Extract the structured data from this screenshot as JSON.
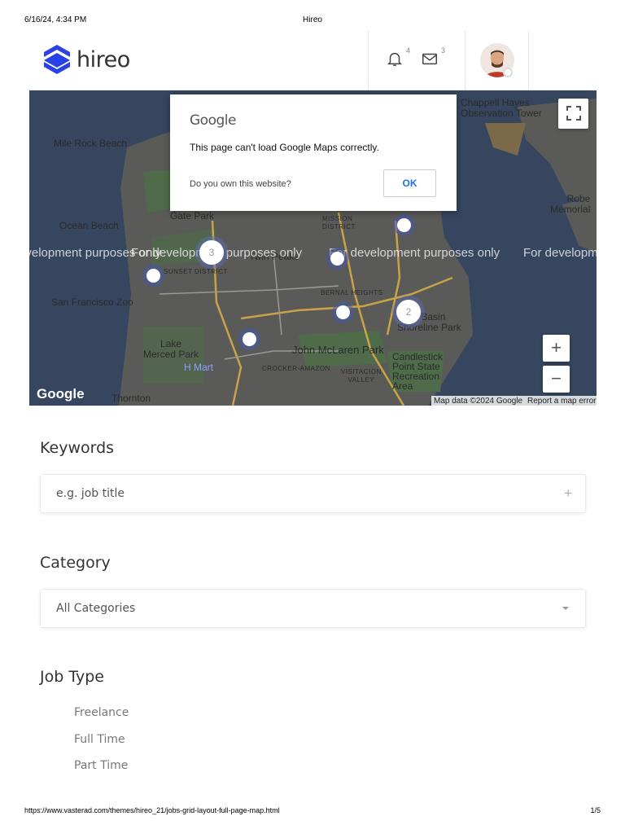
{
  "print": {
    "date": "6/16/24, 4:34 PM",
    "title": "Hireo",
    "url": "https://www.vasterad.com/themes/hireo_21/jobs-grid-layout-full-page-map.html",
    "page": "1/5"
  },
  "header": {
    "logo_text": "hireo",
    "notifications_count": "4",
    "messages_count": "3"
  },
  "map": {
    "labels": {
      "mile_rock_beach": "Mile Rock Beach",
      "ocean_beach": "Ocean Beach",
      "gate_park": "Gate Park",
      "mission_district": "MISSION\nDISTRICT",
      "sunset_district": "SUNSET DISTRICT",
      "san_francisco_zoo": "San Francisco Zoo",
      "lake_merced_park": "Lake\nMerced Park",
      "mart": "H Mart",
      "john_mclaren_park": "John McLaren Park",
      "crocker_amazon": "CROCKER-AMAZON",
      "visitacion_valley": "VISITACION\nVALLEY",
      "bernal_heights": "BERNAL HEIGHTS",
      "candlestick": "Candlestick\nPoint State\nRecreation\nArea",
      "india_basin": "India Basin\nShoreline Park",
      "chappell_hayes": "Chappell Hayes\nObservation Tower",
      "roberts_memorial": "Robe\nMemorial",
      "thornton": "Thornton",
      "twin_peaks": "Twin Peaks"
    },
    "dev_watermark": "For development purposes only",
    "clusters": [
      "3",
      "2"
    ],
    "zoom_in": "+",
    "zoom_out": "−",
    "google_logo": "Google",
    "attribution": "Map data ©2024 Google",
    "report_error": "Report a map error",
    "dialog": {
      "logo": "Google",
      "message": "This page can't load Google Maps correctly.",
      "question": "Do you own this website?",
      "ok": "OK"
    }
  },
  "keywords": {
    "title": "Keywords",
    "placeholder": "e.g. job title",
    "icon": "+"
  },
  "category": {
    "title": "Category",
    "selected": "All Categories"
  },
  "job_type": {
    "title": "Job Type",
    "items": [
      "Freelance",
      "Full Time",
      "Part Time"
    ]
  },
  "colors": {
    "brand": "#2a41e8",
    "link": "#1a73e8",
    "map_water": "#36465f",
    "map_land": "#585858"
  }
}
